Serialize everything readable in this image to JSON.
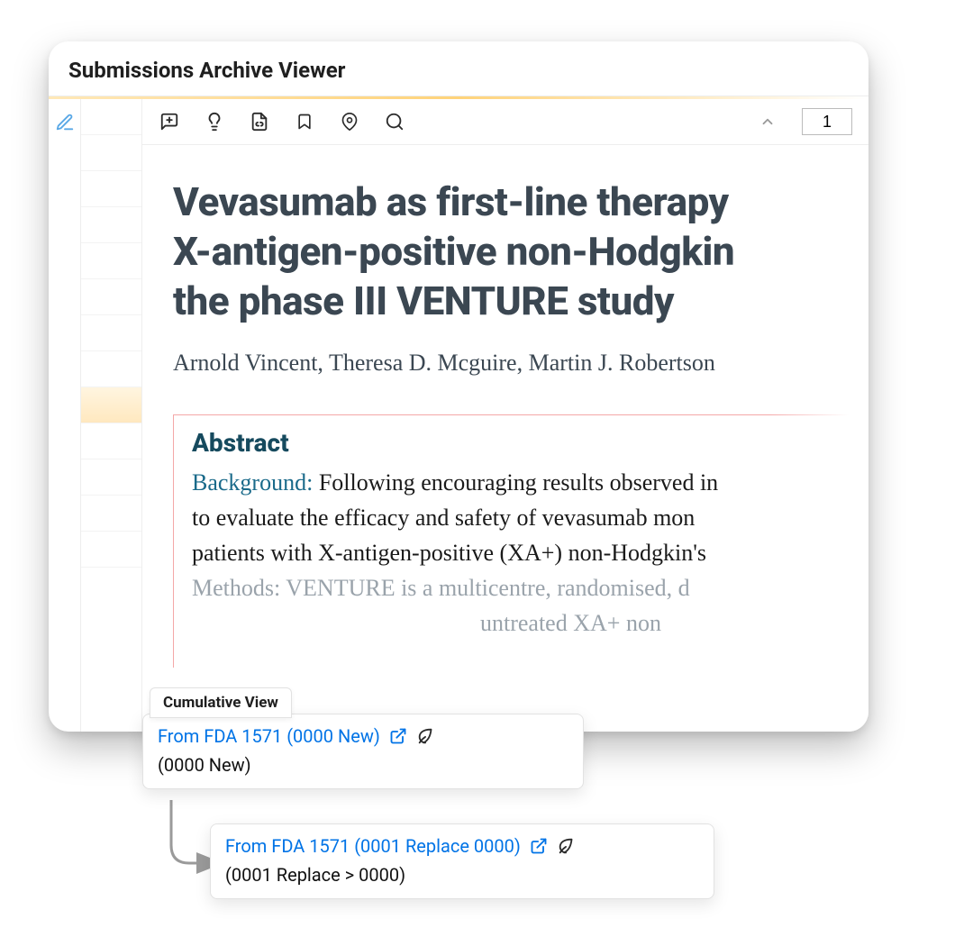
{
  "window": {
    "title": "Submissions Archive Viewer"
  },
  "toolbar": {
    "page_value": "1"
  },
  "document": {
    "title_line1": "Vevasumab as first-line therapy",
    "title_line2": "X-antigen-positive non-Hodgkin",
    "title_line3": "the phase III VENTURE study",
    "authors": "Arnold Vincent, Theresa D. Mcguire, Martin J. Robertson",
    "abstract_heading": "Abstract",
    "abstract_label1": "Background:",
    "abstract_line1_rest": " Following encouraging results observed in",
    "abstract_line2": "to evaluate the efficacy and safety of vevasumab mon",
    "abstract_line3": "patients with X-antigen-positive (XA+) non-Hodgkin's",
    "abstract_line4a": "Methods:",
    "abstract_line4b": " VENTURE is a multicentre, randomised, d",
    "abstract_line5": "untreated XA+ non"
  },
  "cumulative": {
    "label": "Cumulative View",
    "card1_link": "From FDA 1571 (0000 New)",
    "card1_sub": "(0000 New)",
    "card2_link": "From FDA 1571 (0001 Replace 0000)",
    "card2_sub": "(0001 Replace > 0000)"
  }
}
